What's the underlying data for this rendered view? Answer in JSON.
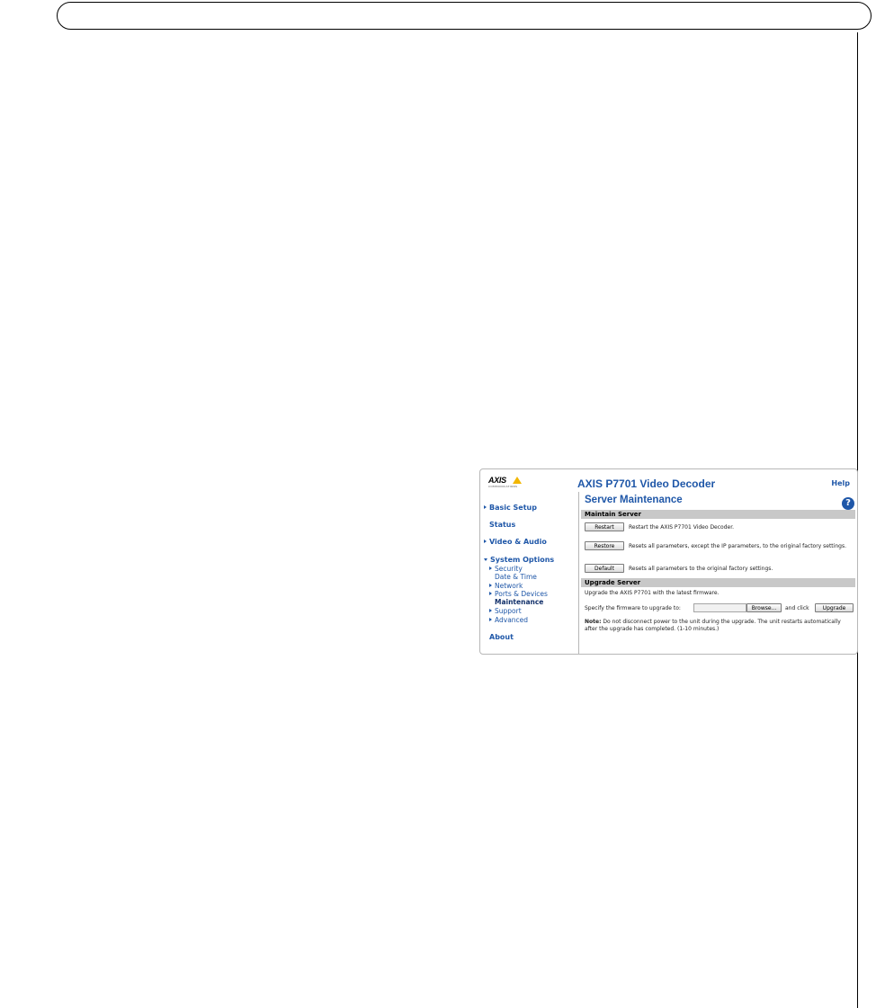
{
  "app": {
    "title": "AXIS P7701 Video Decoder",
    "help_link": "Help",
    "logo_text": "AXIS",
    "logo_subtext": "COMMUNICATIONS"
  },
  "sidebar": {
    "basic_setup": "Basic Setup",
    "status": "Status",
    "video_audio": "Video & Audio",
    "system_options": "System Options",
    "sub_items": [
      "Security",
      "Date & Time",
      "Network",
      "Ports & Devices",
      "Maintenance",
      "Support",
      "Advanced"
    ],
    "about": "About"
  },
  "main": {
    "page_title": "Server Maintenance",
    "help_icon_glyph": "?",
    "maintain_section": "Maintain Server",
    "restart_label": "Restart",
    "restart_desc": "Restart the AXIS P7701 Video Decoder.",
    "restore_label": "Restore",
    "restore_desc": "Resets all parameters, except the IP parameters, to the original factory settings.",
    "default_label": "Default",
    "default_desc": "Resets all parameters to the original factory settings.",
    "upgrade_section": "Upgrade Server",
    "upgrade_intro": "Upgrade the AXIS P7701 with the latest firmware.",
    "specify_label": "Specify the firmware to upgrade to:",
    "firmware_value": "",
    "browse_label": "Browse...",
    "and_click": "and click",
    "upgrade_label": "Upgrade",
    "note_label": "Note:",
    "note_text": " Do not disconnect power to the unit during the upgrade. The unit restarts automatically after the upgrade has completed. (1-10 minutes.)"
  }
}
